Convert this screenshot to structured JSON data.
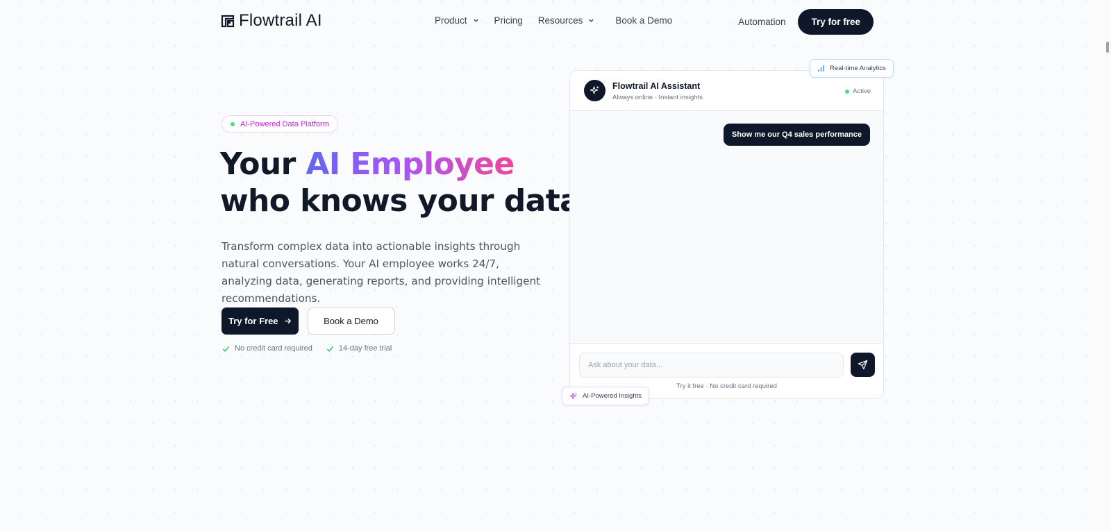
{
  "nav": {
    "brand": "Flowtrail AI",
    "links": [
      {
        "label": "Product"
      },
      {
        "label": "Pricing"
      },
      {
        "label": "Resources"
      },
      {
        "label": "Book a Demo"
      }
    ],
    "automation": "Automation",
    "cta": "Try for free"
  },
  "hero": {
    "badge": "AI-Powered Data Platform",
    "headline_pre": "Your ",
    "headline_highlight": "AI Employee",
    "headline_line2": "who knows your data",
    "lede": "Transform complex data into actionable insights through natural conversations. Your AI employee works 24/7, analyzing data, generating reports, and providing intelligent recommendations.",
    "primary_cta": "Try for Free",
    "secondary_cta": "Book a Demo",
    "checks": [
      "No credit card required",
      "14-day free trial"
    ]
  },
  "chat": {
    "assistant_name": "Flowtrail AI Assistant",
    "assistant_sub": "Always online · Instant insights",
    "status": "Active",
    "user_message": "Show me our Q4 sales performance",
    "input_placeholder": "Ask about your data...",
    "foot_note": "Try it free · No credit card required",
    "tag_analytics": "Real-time Analytics",
    "tag_insights": "AI-Powered Insights"
  },
  "colors": {
    "primary": "#0f172a",
    "gradient_start": "#6366f1",
    "gradient_end": "#ec4899",
    "status_green": "#4ade80"
  }
}
